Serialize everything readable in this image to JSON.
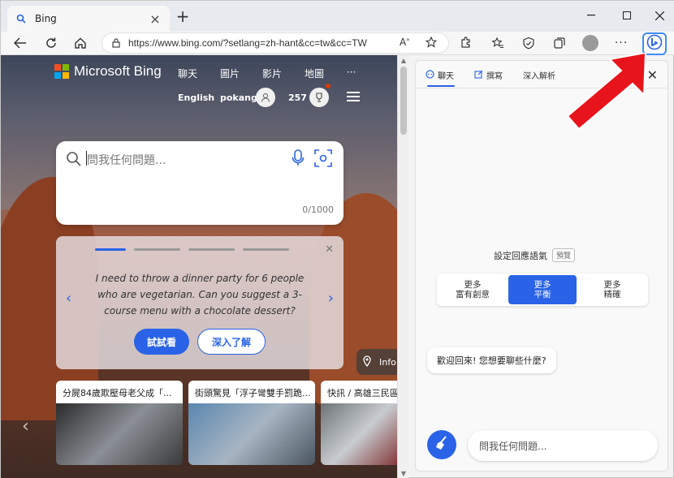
{
  "browser": {
    "tab_title": "Bing",
    "new_tab": "+",
    "url": "https://www.bing.com/?setlang=zh-hant&cc=tw&cc=TW"
  },
  "bing": {
    "logo_text": "Microsoft Bing",
    "nav": [
      "聊天",
      "圖片",
      "影片",
      "地圖",
      "···"
    ],
    "language": "English",
    "username": "pokang",
    "points": "257",
    "search_placeholder": "問我任何問題...",
    "char_count": "0/1000",
    "suggestion_text": "I need to throw a dinner party for 6 people who are vegetarian. Can you suggest a 3-course menu with a chocolate dessert?",
    "try_button": "試試看",
    "learn_button": "深入了解",
    "info_label": "Info",
    "news": [
      {
        "title": "分屍84歲欺壓母老父成「..."
      },
      {
        "title": "街頭驚見「浮子彎雙手罰跪..."
      },
      {
        "title": "快訊 / 高雄三民區"
      }
    ]
  },
  "sidebar": {
    "tabs": [
      "聊天",
      "撰寫",
      "深入解析"
    ],
    "tone_label": "設定回應語氣",
    "tone_badge": "預覽",
    "tones": [
      {
        "line1": "更多",
        "line2": "富有創意"
      },
      {
        "line1": "更多",
        "line2": "平衡"
      },
      {
        "line1": "更多",
        "line2": "精確"
      }
    ],
    "selected_tone": 1,
    "welcome": "歡迎回來! 您想要聊些什麼?",
    "input_placeholder": "問我任何問題..."
  },
  "colors": {
    "accent": "#2a63e7",
    "annotation_arrow": "#e8141b"
  }
}
